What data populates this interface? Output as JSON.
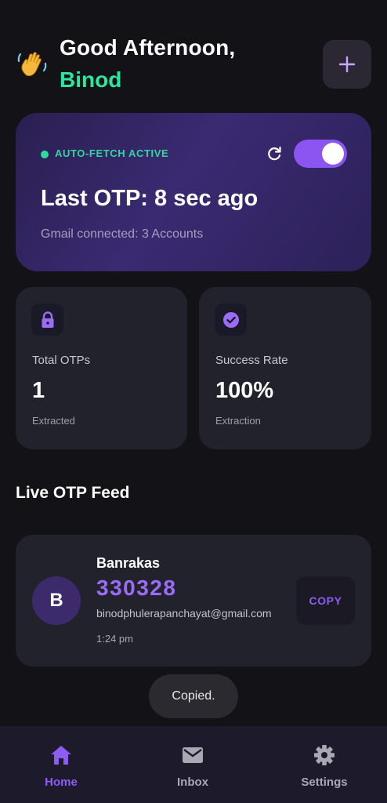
{
  "header": {
    "greeting": "Good Afternoon,",
    "user_name": "Binod",
    "wave_icon": "waving-hand-icon",
    "add_icon": "plus-icon"
  },
  "status_card": {
    "label": "AUTO-FETCH ACTIVE",
    "toggle_on": true,
    "last_otp": "Last OTP: 8 sec ago",
    "gmail_status": "Gmail connected: 3 Accounts"
  },
  "stats": [
    {
      "icon": "lock-icon",
      "label": "Total OTPs",
      "value": "1",
      "sub": "Extracted"
    },
    {
      "icon": "check-circle-icon",
      "label": "Success Rate",
      "value": "100%",
      "sub": "Extraction"
    }
  ],
  "feed": {
    "title": "Live OTP Feed",
    "items": [
      {
        "avatar_initial": "B",
        "sender": "Banrakas",
        "code": "330328",
        "email": "binodphulerapanchayat@gmail.com",
        "time": "1:24 pm",
        "copy_label": "COPY"
      }
    ]
  },
  "toast": "Copied.",
  "nav": {
    "items": [
      {
        "label": "Home",
        "icon": "home-icon",
        "active": true
      },
      {
        "label": "Inbox",
        "icon": "mail-icon",
        "active": false
      },
      {
        "label": "Settings",
        "icon": "gear-icon",
        "active": false
      }
    ]
  },
  "colors": {
    "background": "#131217",
    "accent": "#8d5cf3",
    "success": "#2ee59d",
    "card": "#22222c"
  }
}
